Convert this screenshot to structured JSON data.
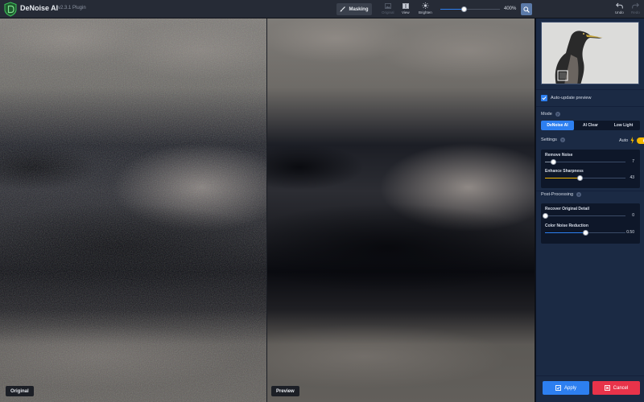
{
  "app": {
    "title": "DeNoise AI",
    "version": "v2.3.1 Plugin"
  },
  "toolbar": {
    "masking_label": "Masking",
    "tools": [
      {
        "label": "Original",
        "icon": "image-icon"
      },
      {
        "label": "View",
        "icon": "split-view-icon"
      },
      {
        "label": "Brighten",
        "icon": "sun-icon"
      }
    ],
    "zoom": {
      "value_text": "400%",
      "level": 0.4
    },
    "undo_label": "Undo",
    "redo_label": "Redo"
  },
  "panes": {
    "left_label": "Original",
    "right_label": "Preview"
  },
  "panel": {
    "auto_update": {
      "label": "Auto-update preview",
      "checked": true
    },
    "mode": {
      "title": "Mode",
      "options": [
        "DeNoise AI",
        "AI Clear",
        "Low Light"
      ],
      "selected": "DeNoise AI"
    },
    "settings": {
      "title": "Settings",
      "auto_label": "Auto",
      "auto_on": true,
      "sliders": [
        {
          "label": "Remove Noise",
          "value": "7",
          "fraction": 0.1
        },
        {
          "label": "Enhance Sharpness",
          "value": "43",
          "fraction": 0.43
        }
      ]
    },
    "post_processing": {
      "title": "Post-Processing",
      "sliders": [
        {
          "label": "Recover Original Detail",
          "value": "0",
          "fraction": 0.0
        },
        {
          "label": "Color Noise Reduction",
          "value": "0.50",
          "fraction": 0.5
        }
      ]
    },
    "apply_label": "Apply",
    "cancel_label": "Cancel"
  },
  "colors": {
    "accent": "#2d7ff0",
    "cancel": "#e8334a",
    "toggle": "#f5b800",
    "panel_bg": "#1b2a44"
  }
}
